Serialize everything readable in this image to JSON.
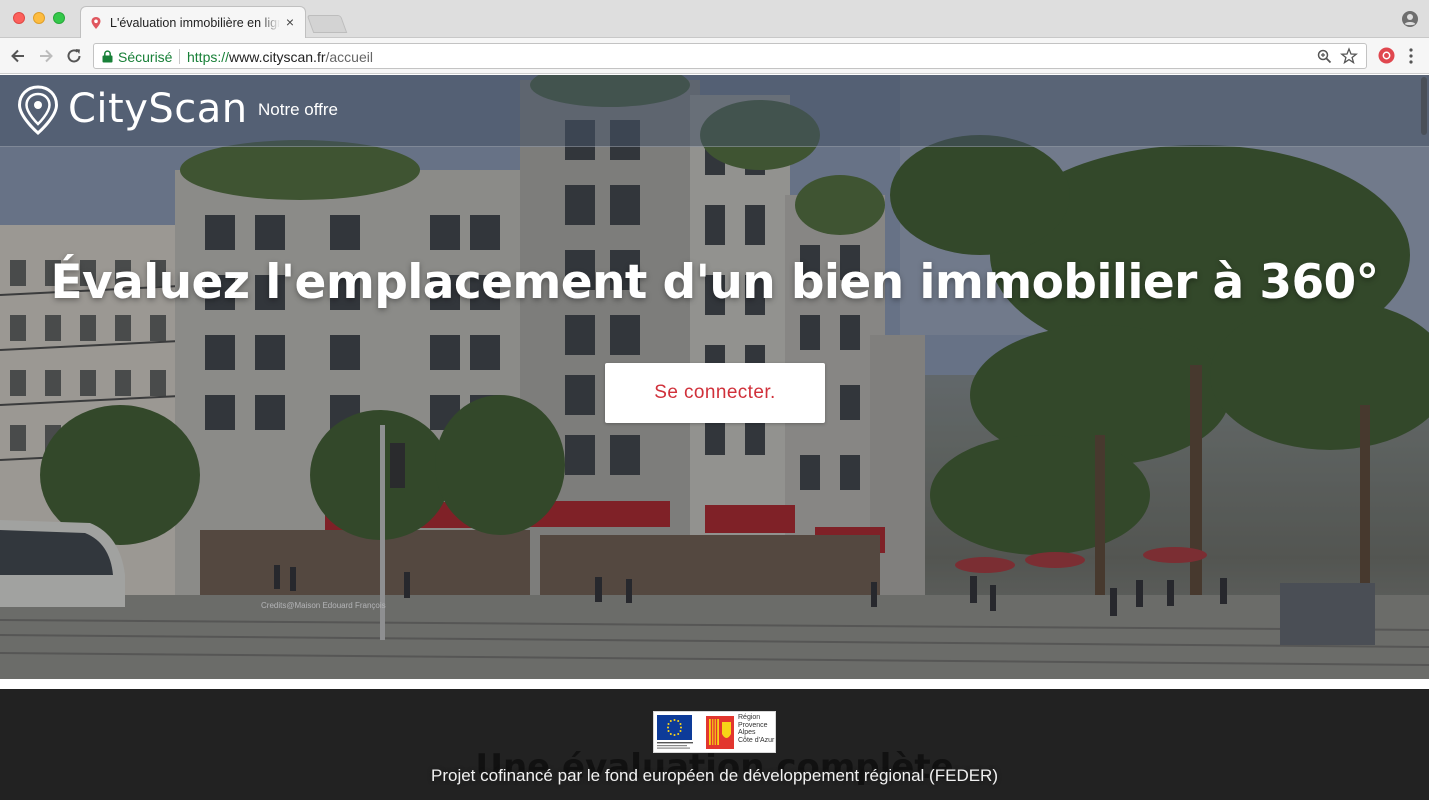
{
  "browser": {
    "tab_title": "L'évaluation immobilière en ligne",
    "tab_close": "×",
    "secure_label": "Sécurisé",
    "url_scheme": "https://",
    "url_host": "www.cityscan.fr",
    "url_path": "/accueil"
  },
  "site": {
    "brand": "CityScan",
    "nav_offer": "Notre offre",
    "headline": "Évaluez l'emplacement d'un bien immobilier à 360°",
    "cta_label": "Se connecter.",
    "next_section_title": "Une évaluation complète",
    "feder_caption": "Projet cofinancé par le fond européen de développement régional (FEDER)",
    "region_caption": [
      "Région",
      "Provence",
      "Alpes",
      "Côte d'Azur"
    ],
    "photo_credit": "Credits@Maison Edouard François"
  },
  "colors": {
    "accent": "#d0303a",
    "footer_bg": "#222222",
    "secure_green": "#188038"
  }
}
